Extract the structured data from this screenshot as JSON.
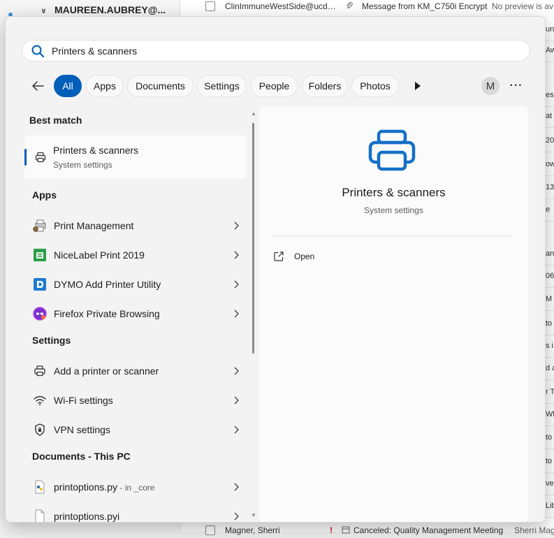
{
  "background": {
    "account": "MAUREEN.AUBREY@...",
    "top_row": {
      "from": "ClinImmuneWestSide@ucde...",
      "subject": "Message from KM_C750i Encrypt",
      "preview": "No preview is av"
    },
    "bottom_row": {
      "from": "Magner, Sherri",
      "subject": "Canceled: Quality Management Meeting",
      "preview": "Sherri Mag"
    },
    "right_fragments": [
      "un",
      "Aw",
      "es",
      "at",
      "20",
      "ow",
      "13",
      "e",
      "and",
      "06",
      "M",
      "to",
      "s i",
      "d a",
      "r Te",
      "Wha",
      "to",
      "to",
      "ve",
      "Lib"
    ]
  },
  "search": {
    "value": "Printers & scanners",
    "icon": "search-icon"
  },
  "filters": {
    "back_icon": "back-arrow-icon",
    "chips": [
      "All",
      "Apps",
      "Documents",
      "Settings",
      "People",
      "Folders",
      "Photos"
    ],
    "active": "All",
    "more_icon": "play-icon",
    "avatar": "M",
    "ellipsis": "···"
  },
  "results": {
    "best_match_header": "Best match",
    "best_match": {
      "title": "Printers & scanners",
      "subtitle": "System settings",
      "icon": "printer-icon"
    },
    "apps_header": "Apps",
    "apps": [
      {
        "label": "Print Management",
        "icon": "print-management-icon"
      },
      {
        "label": "NiceLabel Print 2019",
        "icon": "nicelabel-icon"
      },
      {
        "label": "DYMO Add Printer Utility",
        "icon": "dymo-icon"
      },
      {
        "label": "Firefox Private Browsing",
        "icon": "firefox-private-icon"
      }
    ],
    "settings_header": "Settings",
    "settings": [
      {
        "label": "Add a printer or scanner",
        "icon": "printer-icon"
      },
      {
        "label": "Wi-Fi settings",
        "icon": "wifi-icon"
      },
      {
        "label": "VPN settings",
        "icon": "shield-icon"
      }
    ],
    "documents_header": "Documents - This PC",
    "documents": [
      {
        "label": "printoptions.py",
        "meta": " - in _core",
        "icon": "python-file-icon"
      },
      {
        "label": "printoptions.pyi",
        "meta": "",
        "icon": "file-icon"
      }
    ]
  },
  "preview": {
    "title": "Printers & scanners",
    "subtitle": "System settings",
    "action_label": "Open",
    "action_icon": "open-external-icon"
  },
  "colors": {
    "accent": "#005fb8",
    "panel_bg": "#f3f3f3",
    "card_bg": "#fbfbfb"
  }
}
